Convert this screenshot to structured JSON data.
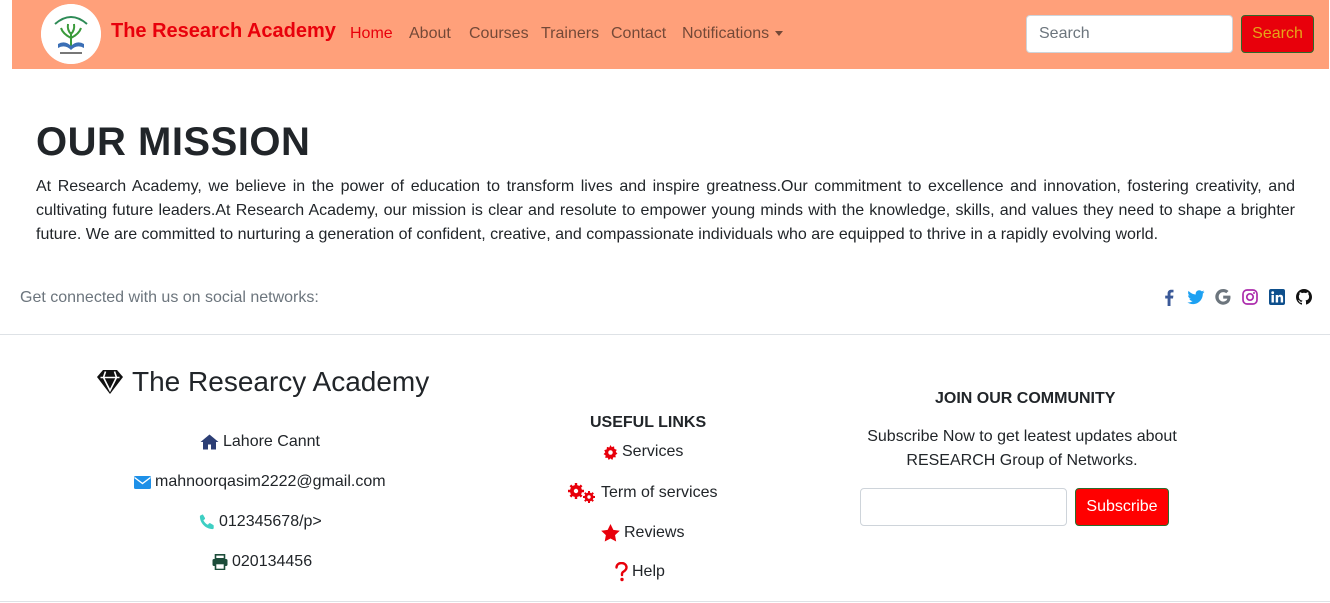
{
  "navbar": {
    "brand": "The Research Academy",
    "links": [
      "Home",
      "About",
      "Courses",
      "Trainers",
      "Contact",
      "Notifications"
    ],
    "search_placeholder": "Search",
    "search_button": "Search"
  },
  "mission": {
    "title": "OUR MISSION",
    "text": "At Research Academy, we believe in the power of education to transform lives and inspire greatness.Our commitment to excellence and innovation, fostering creativity, and cultivating future leaders.At Research Academy, our mission is clear and resolute to empower young minds with the knowledge, skills, and values they need to shape a brighter future. We are committed to nurturing a generation of confident, creative, and compassionate individuals who are equipped to thrive in a rapidly evolving world."
  },
  "social": {
    "text": "Get connected with us on social networks:",
    "icons": [
      "facebook-icon",
      "twitter-icon",
      "google-icon",
      "instagram-icon",
      "linkedin-icon",
      "github-icon"
    ]
  },
  "footer": {
    "brand": "The Researcy Academy",
    "contacts": {
      "address": "Lahore Cannt",
      "email": "mahnoorqasim2222@gmail.com",
      "phone": "012345678/p>",
      "fax": "020134456"
    },
    "useful_links": {
      "title": "USEFUL LINKS",
      "items": [
        "Services",
        "Term of services",
        "Reviews",
        "Help"
      ]
    },
    "community": {
      "title": "JOIN OUR COMMUNITY",
      "text": "Subscribe Now to get leatest updates about RESEARCH Group of Networks.",
      "button": "Subscribe"
    }
  }
}
